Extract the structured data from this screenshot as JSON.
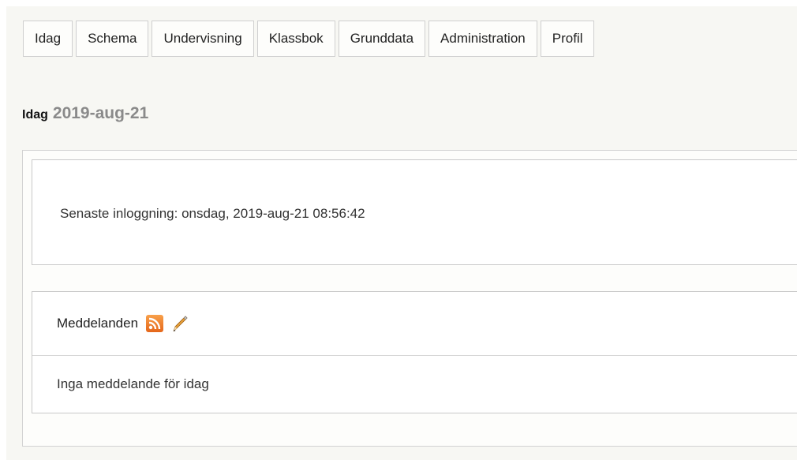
{
  "nav": {
    "tabs": [
      {
        "label": "Idag"
      },
      {
        "label": "Schema"
      },
      {
        "label": "Undervisning"
      },
      {
        "label": "Klassbok"
      },
      {
        "label": "Grunddata"
      },
      {
        "label": "Administration"
      },
      {
        "label": "Profil"
      }
    ]
  },
  "heading": {
    "label": "Idag",
    "date": "2019-aug-21"
  },
  "login": {
    "text": "Senaste inloggning: onsdag, 2019-aug-21 08:56:42"
  },
  "messages": {
    "title": "Meddelanden",
    "icons": [
      "rss-feed-icon",
      "pencil-edit-icon"
    ],
    "empty_text": "Inga meddelande för idag"
  }
}
